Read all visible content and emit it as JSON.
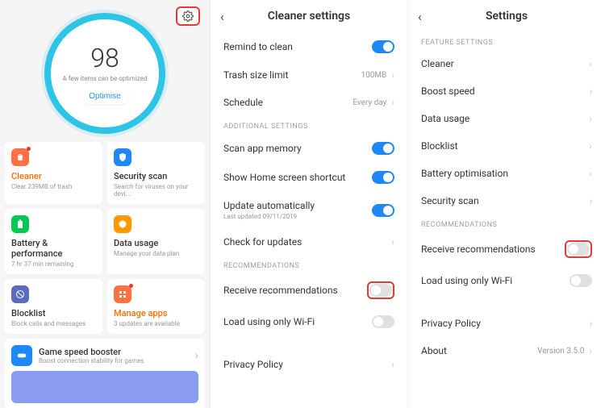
{
  "panel1": {
    "score": "98",
    "sub": "A few items can be optimized",
    "optimise": "Optimise",
    "cards": [
      {
        "title": "Cleaner",
        "sub": "Clear 239MB of trash",
        "accent": "orange",
        "icon": "trash",
        "color": "#ff7043",
        "dot": true
      },
      {
        "title": "Security scan",
        "sub": "Search for viruses on your devi...",
        "icon": "shield",
        "color": "#1e88f7"
      },
      {
        "title": "Battery & performance",
        "sub": "7 hr 37 min remaining",
        "icon": "battery",
        "color": "#00c853"
      },
      {
        "title": "Data usage",
        "sub": "Manage your data plan",
        "icon": "data",
        "color": "#ff9800"
      },
      {
        "title": "Blocklist",
        "sub": "Block calls and messages",
        "icon": "block",
        "color": "#5c6bc0"
      },
      {
        "title": "Manage apps",
        "sub": "3 updates are available",
        "accent": "orange",
        "icon": "apps",
        "color": "#ff7043",
        "dot": true
      }
    ],
    "booster": {
      "title": "Game speed booster",
      "sub": "Boost connection stability for games"
    }
  },
  "panel2": {
    "title": "Cleaner settings",
    "rows_top": [
      {
        "label": "Remind to clean",
        "type": "toggle",
        "on": true
      },
      {
        "label": "Trash size limit",
        "type": "value",
        "value": "100MB"
      },
      {
        "label": "Schedule",
        "type": "value",
        "value": "Every day"
      }
    ],
    "additional_hdr": "ADDITIONAL SETTINGS",
    "rows_add": [
      {
        "label": "Scan app memory",
        "type": "toggle",
        "on": true
      },
      {
        "label": "Show Home screen shortcut",
        "type": "toggle",
        "on": true
      },
      {
        "label": "Update automatically",
        "sub": "Last updated 09/11/2019",
        "type": "toggle",
        "on": true
      },
      {
        "label": "Check for updates",
        "type": "nav"
      }
    ],
    "rec_hdr": "RECOMMENDATIONS",
    "rows_rec": [
      {
        "label": "Receive recommendations",
        "type": "toggle",
        "on": false,
        "hl": true
      },
      {
        "label": "Load using only Wi-Fi",
        "type": "toggle",
        "on": false
      }
    ],
    "privacy": "Privacy Policy"
  },
  "panel3": {
    "title": "Settings",
    "feature_hdr": "FEATURE SETTINGS",
    "rows_feat": [
      {
        "label": "Cleaner"
      },
      {
        "label": "Boost speed"
      },
      {
        "label": "Data usage"
      },
      {
        "label": "Blocklist"
      },
      {
        "label": "Battery optimisation"
      },
      {
        "label": "Security scan"
      }
    ],
    "rec_hdr": "RECOMMENDATIONS",
    "rows_rec": [
      {
        "label": "Receive recommendations",
        "type": "toggle",
        "on": false,
        "hl": true
      },
      {
        "label": "Load using only Wi-Fi",
        "type": "toggle",
        "on": false
      }
    ],
    "privacy": "Privacy Policy",
    "about": {
      "label": "About",
      "value": "Version 3.5.0"
    }
  }
}
